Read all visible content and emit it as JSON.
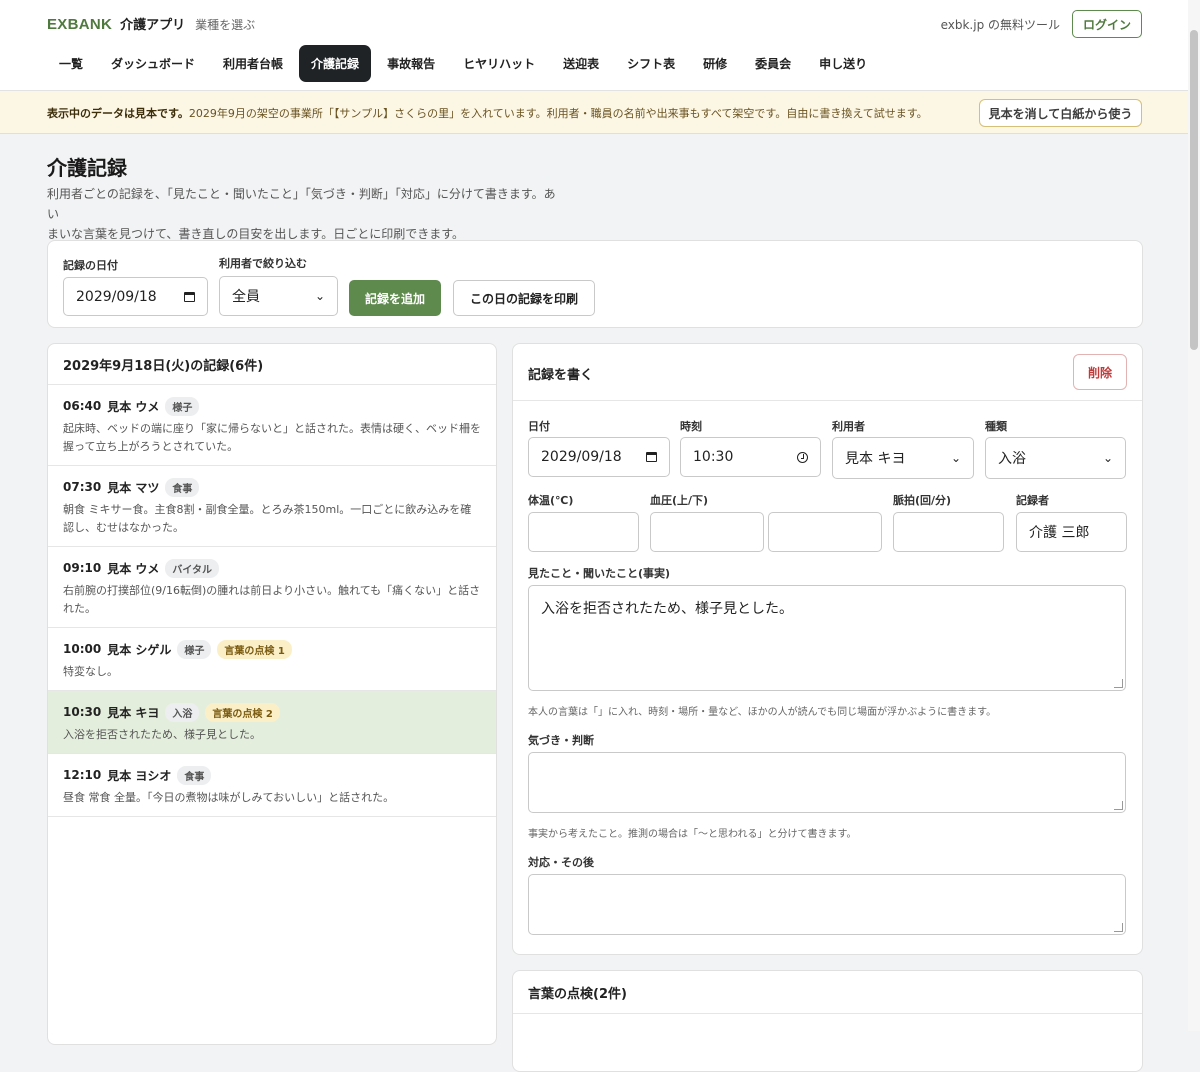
{
  "brand": {
    "logo": "EXBANK",
    "app": "介護アプリ",
    "select_industry": "業種を選ぶ"
  },
  "header": {
    "tool_link": "exbk.jp の無料ツール",
    "login": "ログイン"
  },
  "nav": {
    "tabs": [
      {
        "label": "一覧"
      },
      {
        "label": "ダッシュボード"
      },
      {
        "label": "利用者台帳"
      },
      {
        "label": "介護記録",
        "active": true
      },
      {
        "label": "事故報告"
      },
      {
        "label": "ヒヤリハット"
      },
      {
        "label": "送迎表"
      },
      {
        "label": "シフト表"
      },
      {
        "label": "研修"
      },
      {
        "label": "委員会"
      },
      {
        "label": "申し送り"
      }
    ]
  },
  "banner": {
    "bold": "表示中のデータは見本です。",
    "text": "2029年9月の架空の事業所「【サンプル】さくらの里」を入れています。利用者・職員の名前や出来事もすべて架空です。自由に書き換えて試せます。",
    "button": "見本を消して白紙から使う"
  },
  "page": {
    "title": "介護記録",
    "desc1": "利用者ごとの記録を、「見たこと・聞いたこと」「気づき・判断」「対応」に分けて書きます。あい",
    "desc2": "まいな言葉を見つけて、書き直しの目安を出します。日ごとに印刷できます。"
  },
  "filter": {
    "date_label": "記録の日付",
    "date_value": "2029/09/18",
    "user_label": "利用者で絞り込む",
    "user_value": "全員",
    "add_button": "記録を追加",
    "print_button": "この日の記録を印刷"
  },
  "list": {
    "heading": "2029年9月18日(火)の記録(6件)",
    "records": [
      {
        "time": "06:40",
        "name": "見本 ウメ",
        "tag": "様子",
        "check": "",
        "body": "起床時、ベッドの端に座り「家に帰らないと」と話された。表情は硬く、ベッド柵を握って立ち上がろうとされていた。"
      },
      {
        "time": "07:30",
        "name": "見本 マツ",
        "tag": "食事",
        "check": "",
        "body": "朝食 ミキサー食。主食8割・副食全量。とろみ茶150ml。一口ごとに飲み込みを確認し、むせはなかった。"
      },
      {
        "time": "09:10",
        "name": "見本 ウメ",
        "tag": "バイタル",
        "check": "",
        "body": "右前腕の打撲部位(9/16転倒)の腫れは前日より小さい。触れても「痛くない」と話された。"
      },
      {
        "time": "10:00",
        "name": "見本 シゲル",
        "tag": "様子",
        "check": "言葉の点検 1",
        "body": "特変なし。"
      },
      {
        "time": "10:30",
        "name": "見本 キヨ",
        "tag": "入浴",
        "check": "言葉の点検 2",
        "body": "入浴を拒否されたため、様子見とした。",
        "selected": true
      },
      {
        "time": "12:10",
        "name": "見本 ヨシオ",
        "tag": "食事",
        "check": "",
        "body": "昼食 常食 全量。「今日の煮物は味がしみておいしい」と話された。"
      }
    ]
  },
  "form": {
    "title": "記録を書く",
    "delete": "削除",
    "date_label": "日付",
    "date_value": "2029/09/18",
    "time_label": "時刻",
    "time_value": "10:30",
    "user_label": "利用者",
    "user_value": "見本 キヨ",
    "type_label": "種類",
    "type_value": "入浴",
    "temp_label": "体温(℃)",
    "bp_label": "血圧(上/下)",
    "pulse_label": "脈拍(回/分)",
    "recorder_label": "記録者",
    "recorder_value": "介護 三郎",
    "fact_label": "見たこと・聞いたこと(事実)",
    "fact_value": "入浴を拒否されたため、様子見とした。",
    "fact_hint": "本人の言葉は「」に入れ、時刻・場所・量など、ほかの人が読んでも同じ場面が浮かぶように書きます。",
    "judge_label": "気づき・判断",
    "judge_hint": "事実から考えたこと。推測の場合は「〜と思われる」と分けて書きます。",
    "action_label": "対応・その後"
  },
  "check_panel": {
    "heading": "言葉の点検(2件)"
  }
}
